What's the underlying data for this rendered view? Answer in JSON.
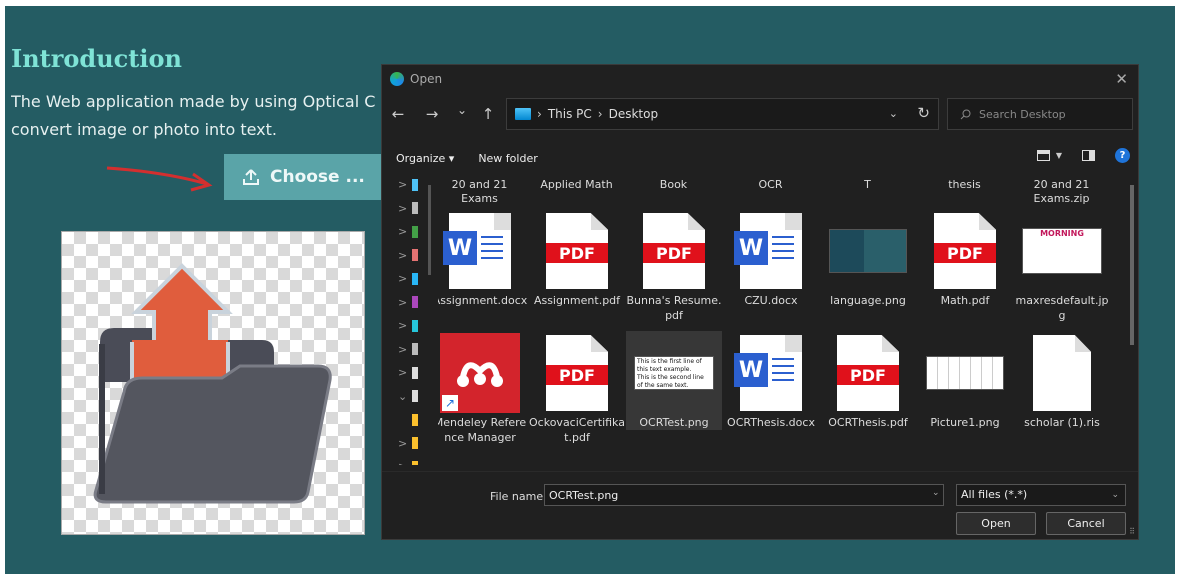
{
  "page": {
    "title": "Introduction",
    "intro_line1": "The Web application made by using Optical C",
    "intro_line2": "convert image or photo into text.",
    "choose_label": "Choose ..."
  },
  "dialog": {
    "title": "Open",
    "close": "✕",
    "nav": {
      "back": "←",
      "forward": "→",
      "recent": "⌄",
      "up": "↑"
    },
    "breadcrumb": [
      "This PC",
      "Desktop"
    ],
    "refresh": "↻",
    "search_placeholder": "Search Desktop",
    "toolbar": {
      "organize": "Organize ▾",
      "new_folder": "New folder",
      "help": "?"
    },
    "tree_chevrons": [
      ">",
      ">",
      ">",
      ">",
      ">",
      ">",
      ">",
      ">",
      ">",
      "⌄",
      "",
      ">",
      ">",
      ">"
    ],
    "folders": [
      "20 and 21 Exams",
      "Applied Math",
      "Book",
      "OCR",
      "T",
      "thesis",
      "20 and 21 Exams.zip"
    ],
    "files_row1": [
      {
        "name": "Assignment.docx",
        "kind": "word"
      },
      {
        "name": "Assignment.pdf",
        "kind": "pdf"
      },
      {
        "name": "Bunna's Resume.pdf",
        "kind": "pdf"
      },
      {
        "name": "CZU.docx",
        "kind": "word"
      },
      {
        "name": "language.png",
        "kind": "image"
      },
      {
        "name": "Math.pdf",
        "kind": "pdf"
      },
      {
        "name": "maxresdefault.jpg",
        "kind": "image"
      }
    ],
    "files_row2": [
      {
        "name": "Mendeley Reference Manager",
        "kind": "app"
      },
      {
        "name": "OckovaciCertifikat.pdf",
        "kind": "pdf"
      },
      {
        "name": "OCRTest.png",
        "kind": "image"
      },
      {
        "name": "OCRThesis.docx",
        "kind": "word"
      },
      {
        "name": "OCRThesis.pdf",
        "kind": "pdf"
      },
      {
        "name": "Picture1.png",
        "kind": "image"
      },
      {
        "name": "scholar (1).ris",
        "kind": "blank"
      }
    ],
    "pdf_label": "PDF",
    "word_label": "W",
    "ocr_thumb_lines": [
      "This is the first line of",
      "this text example.",
      "This is the second line",
      "of the same text."
    ],
    "maxres_thumb_title": "MORNING",
    "file_name_label": "File name:",
    "file_name_value": "OCRTest.png",
    "file_type": "All files (*.*)",
    "open_label": "Open",
    "cancel_label": "Cancel"
  },
  "colors": {
    "page_bg": "#245c63",
    "heading": "#7fe3d6",
    "button": "#5aa4a8",
    "arrow": "#d32f2f",
    "pdf_red": "#e0111b",
    "word_blue": "#2b5fcf",
    "dialog_bg": "#202020"
  }
}
